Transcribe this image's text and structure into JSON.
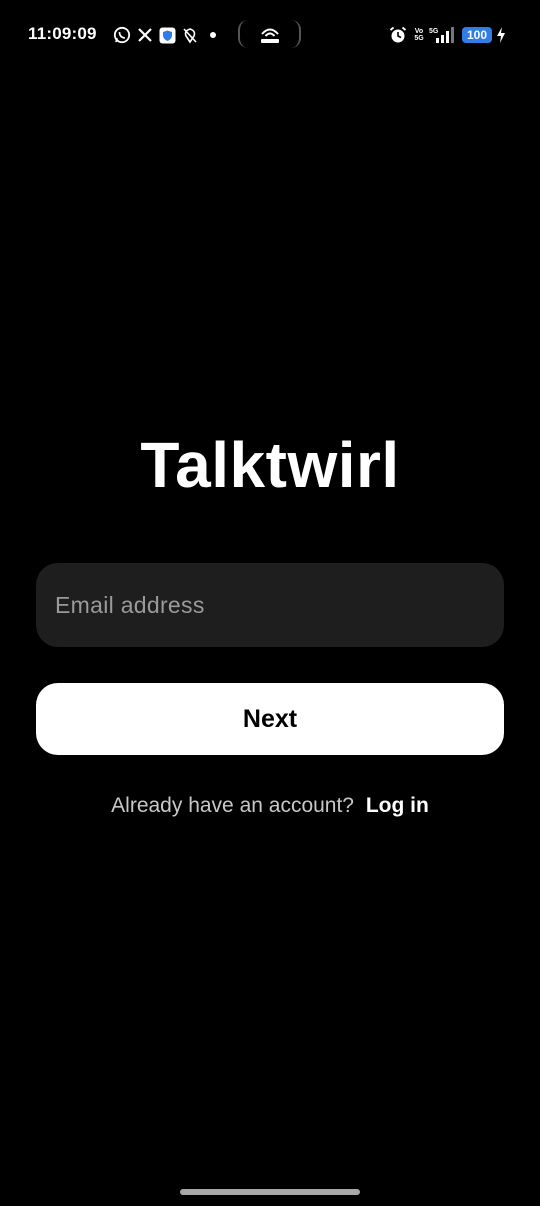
{
  "status_bar": {
    "time": "11:09:09",
    "notification_icons": [
      "whatsapp-icon",
      "x-icon",
      "shield-icon",
      "location-off-icon",
      "dot-icon"
    ],
    "center_icon": "hotspot-icon",
    "right_icons": [
      "alarm-icon",
      "volte-icon",
      "signal-5g-icon",
      "battery-icon",
      "charging-icon"
    ],
    "volte_label_top": "Vo",
    "volte_label_bottom": "5G",
    "network_label": "5G",
    "battery_level": "100",
    "battery_color": "#2f7ee8"
  },
  "app": {
    "title": "Talktwirl"
  },
  "form": {
    "email_placeholder": "Email address",
    "email_value": "",
    "next_label": "Next"
  },
  "footer": {
    "prompt": "Already have an account?",
    "login_label": "Log in"
  },
  "colors": {
    "background": "#000000",
    "input_background": "#1e1e1e",
    "button_background": "#ffffff",
    "button_text": "#000000"
  }
}
